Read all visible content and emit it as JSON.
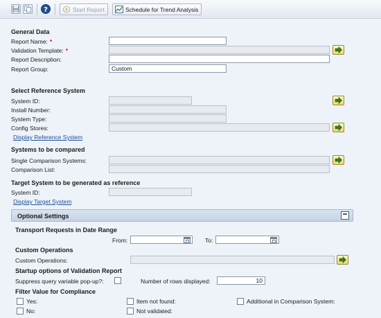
{
  "toolbar": {
    "save_icon": "save-icon",
    "copy_icon": "copy-icon",
    "help_icon": "help-icon",
    "start_report": "Start Report",
    "schedule": "Schedule for Trend Analysis"
  },
  "general": {
    "title": "General Data",
    "report_name_label": "Report Name:",
    "report_name_value": "",
    "validation_template_label": "Validation Template:",
    "validation_template_value": "",
    "report_description_label": "Report Description:",
    "report_description_value": "",
    "report_group_label": "Report Group:",
    "report_group_value": "Custom",
    "required_mark": "*"
  },
  "reference": {
    "title": "Select Reference System",
    "system_id_label": "System ID:",
    "install_number_label": "Install Number:",
    "system_type_label": "System Type:",
    "config_stores_label": "Config Stores:",
    "display_link": "Display Reference System"
  },
  "compared": {
    "title": "Systems to be compared",
    "single_label": "Single Comparison Systems:",
    "list_label": "Comparison List:"
  },
  "target": {
    "title": "Target System to be generated as reference",
    "system_id_label": "System ID:",
    "display_link": "Display Target System"
  },
  "optional": {
    "title": "Optional Settings",
    "transport_title": "Transport Requests in Date Range",
    "from_label": "From:",
    "to_label": "To:",
    "custom_ops_title": "Custom Operations",
    "custom_ops_label": "Custom Operations:",
    "startup_title": "Startup options of Validation Report",
    "suppress_label": "Suppress query variable pop-up?:",
    "rows_label": "Number of rows displayed:",
    "rows_value": "10",
    "filter_title": "Filter Value for Compliance",
    "yes_label": "Yes:",
    "no_label": "No:",
    "item_not_found_label": "Item not found:",
    "not_validated_label": "Not validated:",
    "additional_label": "Additional in Comparison System:"
  },
  "colors": {
    "background": "#eef3f9",
    "panel": "#c5d3e4",
    "link": "#1d4fa0",
    "required": "#d31414"
  }
}
